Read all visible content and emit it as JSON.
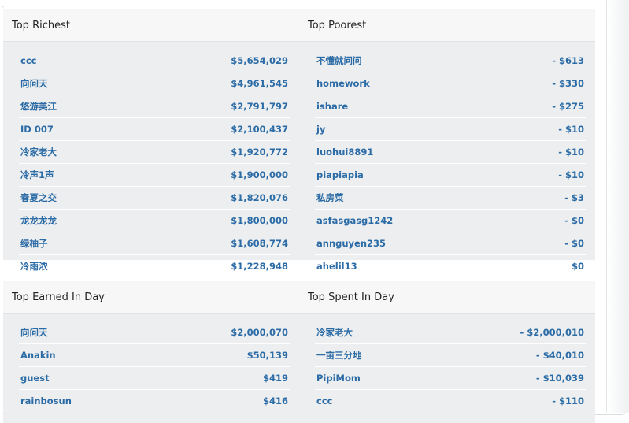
{
  "panels": {
    "richest": {
      "title": "Top Richest",
      "rows": [
        {
          "name": "ccc",
          "amount": "$5,654,029"
        },
        {
          "name": "向问天",
          "amount": "$4,961,545"
        },
        {
          "name": "悠游美江",
          "amount": "$2,791,797"
        },
        {
          "name": "ID 007",
          "amount": "$2,100,437"
        },
        {
          "name": "冷家老大",
          "amount": "$1,920,772"
        },
        {
          "name": "冷声1声",
          "amount": "$1,900,000"
        },
        {
          "name": "春夏之交",
          "amount": "$1,820,076"
        },
        {
          "name": "龙龙龙龙",
          "amount": "$1,800,000"
        },
        {
          "name": "绿柚子",
          "amount": "$1,608,774"
        },
        {
          "name": "冷雨浓",
          "amount": "$1,228,948"
        }
      ]
    },
    "poorest": {
      "title": "Top Poorest",
      "rows": [
        {
          "name": "不懂就问问",
          "amount": "- $613"
        },
        {
          "name": "homework",
          "amount": "- $330"
        },
        {
          "name": "ishare",
          "amount": "- $275"
        },
        {
          "name": "jy",
          "amount": "- $10"
        },
        {
          "name": "luohui8891",
          "amount": "- $10"
        },
        {
          "name": "piapiapia",
          "amount": "- $10"
        },
        {
          "name": "私房菜",
          "amount": "- $3"
        },
        {
          "name": "asfasgasg1242",
          "amount": "- $0"
        },
        {
          "name": "annguyen235",
          "amount": "- $0"
        },
        {
          "name": "ahelil13",
          "amount": "$0"
        }
      ]
    },
    "earned": {
      "title": "Top Earned In Day",
      "rows": [
        {
          "name": "向问天",
          "amount": "$2,000,070"
        },
        {
          "name": "Anakin",
          "amount": "$50,139"
        },
        {
          "name": "guest",
          "amount": "$419"
        },
        {
          "name": "rainbosun",
          "amount": "$416"
        }
      ]
    },
    "spent": {
      "title": "Top Spent In Day",
      "rows": [
        {
          "name": "冷家老大",
          "amount": "- $2,000,010"
        },
        {
          "name": "一亩三分地",
          "amount": "- $40,010"
        },
        {
          "name": "PipiMom",
          "amount": "- $10,039"
        },
        {
          "name": "ccc",
          "amount": "- $110"
        }
      ]
    }
  }
}
